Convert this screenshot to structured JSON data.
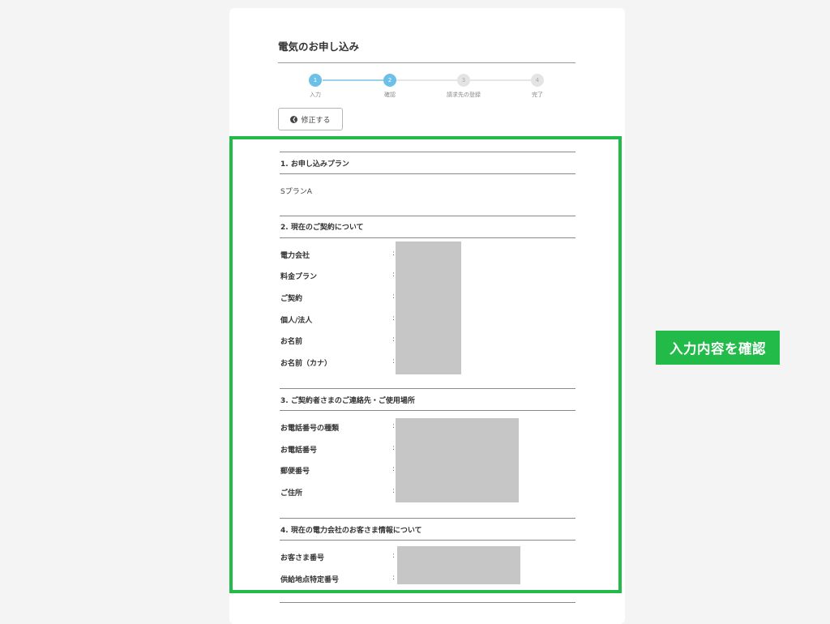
{
  "page": {
    "title": "電気のお申し込み"
  },
  "steps": [
    {
      "num": "1",
      "label": "入力",
      "state": "done"
    },
    {
      "num": "2",
      "label": "確認",
      "state": "current"
    },
    {
      "num": "3",
      "label": "請求先の登録",
      "state": "todo"
    },
    {
      "num": "4",
      "label": "完了",
      "state": "todo"
    }
  ],
  "back_button": {
    "label": "修正する",
    "icon": "chevron-left-circle-icon"
  },
  "callout": {
    "text": "入力内容を確認"
  },
  "sections": {
    "plan": {
      "title": "1. お申し込みプラン",
      "value": "SプランA"
    },
    "contract": {
      "title": "2. 現在のご契約について",
      "rows": [
        "電力会社",
        "料金プラン",
        "ご契約",
        "個人/法人",
        "お名前",
        "お名前（カナ）"
      ]
    },
    "contact": {
      "title": "3. ご契約者さまのご連絡先・ご使用場所",
      "rows": [
        "お電話番号の種類",
        "お電話番号",
        "郵便番号",
        "ご住所"
      ]
    },
    "customer": {
      "title": "4. 現在の電力会社のお客さま情報について",
      "rows": [
        "お客さま番号",
        "供給地点特定番号"
      ]
    }
  },
  "colon": ":",
  "colors": {
    "highlight": "#22bb4a",
    "step_active": "#6cc0e8",
    "redaction": "#c6c6c6"
  }
}
